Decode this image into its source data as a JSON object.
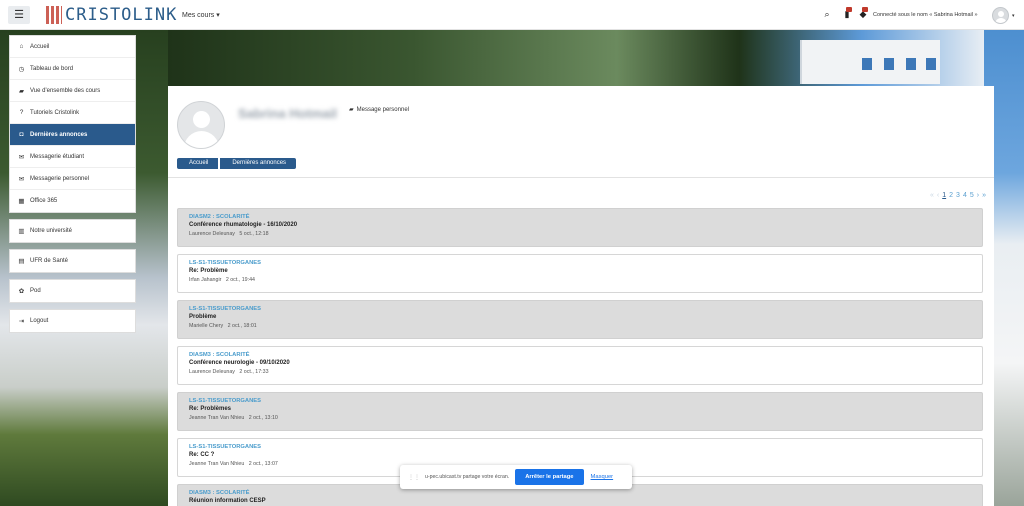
{
  "navbar": {
    "menu_icon": "hamburger-icon",
    "logo_text": "CRISTOLINK",
    "mes_cours": "Mes cours ▾",
    "connected_text": "Connecté sous le nom « Sabrina Hotmail » ",
    "notif_count": "1",
    "msg_count": "1"
  },
  "sidebar": {
    "group1": [
      {
        "label": "Accueil",
        "icon": "home-icon"
      },
      {
        "label": "Tableau de bord",
        "icon": "dashboard-icon"
      },
      {
        "label": "Vue d'ensemble des cours",
        "icon": "graduation-cap-icon"
      },
      {
        "label": "Tutoriels Cristolink",
        "icon": "question-icon"
      },
      {
        "label": "Dernières annonces",
        "icon": "comments-icon",
        "active": true
      },
      {
        "label": "Messagerie étudiant",
        "icon": "envelope-icon"
      },
      {
        "label": "Messagerie personnel",
        "icon": "envelope-icon"
      },
      {
        "label": "Office 365",
        "icon": "windows-icon"
      }
    ],
    "group2": [
      {
        "label": "Notre université",
        "icon": "university-icon"
      }
    ],
    "group3": [
      {
        "label": "UFR de Santé",
        "icon": "building-icon"
      }
    ],
    "group4": [
      {
        "label": "Pod",
        "icon": "gear-icon"
      }
    ],
    "group5": [
      {
        "label": "Logout",
        "icon": "logout-icon"
      }
    ]
  },
  "profile": {
    "name": "Sabrina Hotmail",
    "message_link": "Message personnel"
  },
  "breadcrumb": [
    "Accueil",
    "Dernières annonces"
  ],
  "pagination": {
    "first": "«",
    "prev": "‹",
    "pages": [
      "1",
      "2",
      "3",
      "4",
      "5"
    ],
    "current": "1",
    "next": "›",
    "last": "»"
  },
  "posts": [
    {
      "course": "DIASM2 : SCOLARITÉ",
      "subject": "Conférence rhumatologie - 16/10/2020",
      "author": "Laurence Deleunay",
      "date": "5 oct., 12:18"
    },
    {
      "course": "LS-S1-TISSUETORGANES",
      "subject": "Re: Problème",
      "author": "Irfan Jahangir",
      "date": "2 oct., 19:44"
    },
    {
      "course": "LS-S1-TISSUETORGANES",
      "subject": "Problème",
      "author": "Marielle Chery",
      "date": "2 oct., 18:01"
    },
    {
      "course": "DIASM3 : SCOLARITÉ",
      "subject": "Conférence neurologie - 09/10/2020",
      "author": "Laurence Deleunay",
      "date": "2 oct., 17:33"
    },
    {
      "course": "LS-S1-TISSUETORGANES",
      "subject": "Re: Problèmes",
      "author": "Jeanne Tran Van Nhieu",
      "date": "2 oct., 13:10"
    },
    {
      "course": "LS-S1-TISSUETORGANES",
      "subject": "Re: CC ?",
      "author": "Jeanne Tran Van Nhieu",
      "date": "2 oct., 13:07"
    },
    {
      "course": "DIASM3 : SCOLARITÉ",
      "subject": "Réunion information CESP",
      "author": "",
      "date": ""
    }
  ],
  "share_bar": {
    "text": "u-pec.ubicast.tv partage votre écran.",
    "stop_label": "Arrêter le partage",
    "hide_label": "Masquer"
  }
}
